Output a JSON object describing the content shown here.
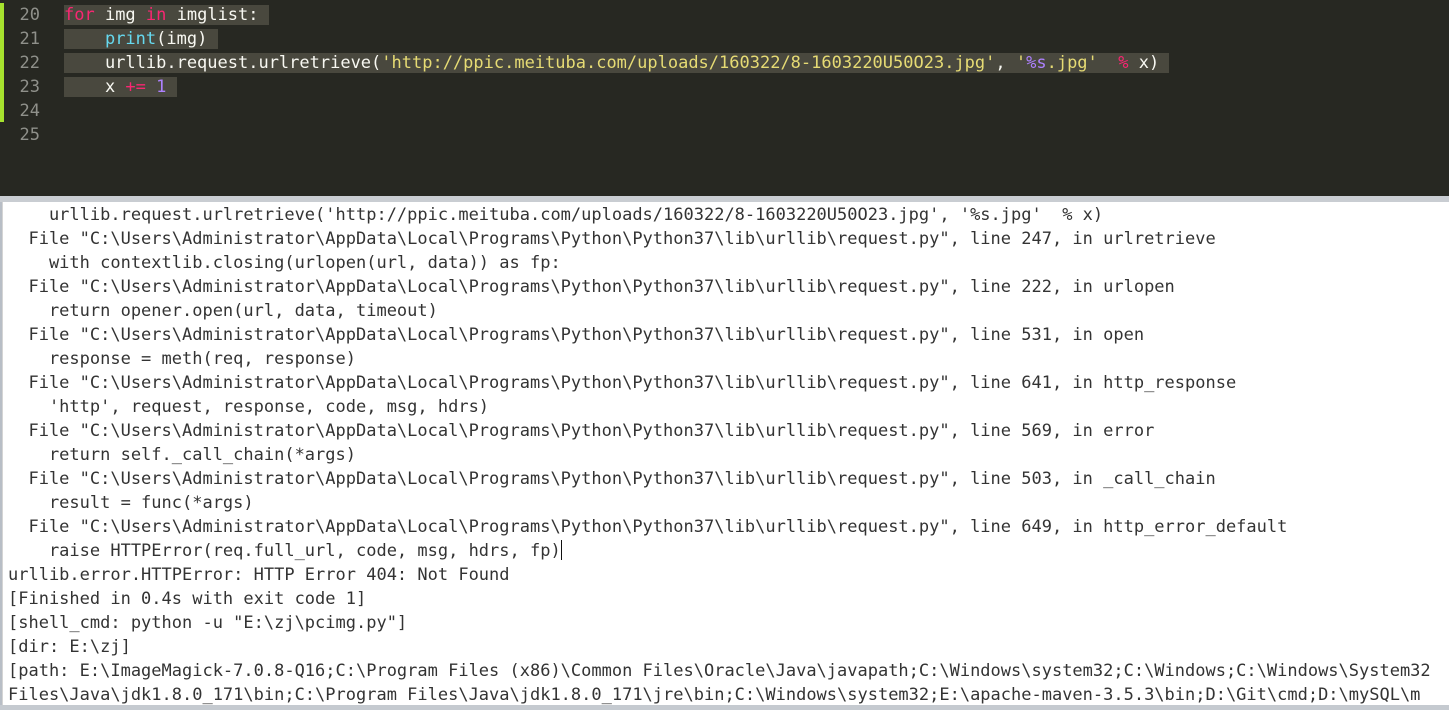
{
  "editor": {
    "lines": [
      {
        "num": "20",
        "segments": [
          {
            "t": "for",
            "c": "kw"
          },
          {
            "t": " img ",
            "c": ""
          },
          {
            "t": "in",
            "c": "kw"
          },
          {
            "t": " imglist: ",
            "c": ""
          }
        ]
      },
      {
        "num": "21",
        "segments": [
          {
            "t": "    ",
            "c": ""
          },
          {
            "t": "print",
            "c": "fn"
          },
          {
            "t": "(img) ",
            "c": ""
          }
        ]
      },
      {
        "num": "22",
        "segments": [
          {
            "t": "    urllib.request.urlretrieve(",
            "c": ""
          },
          {
            "t": "'http://ppic.meituba.com/uploads/160322/8-1603220U50O23.jpg'",
            "c": "str"
          },
          {
            "t": ", ",
            "c": ""
          },
          {
            "t": "'",
            "c": "str"
          },
          {
            "t": "%s",
            "c": "fmt"
          },
          {
            "t": ".jpg'",
            "c": "str"
          },
          {
            "t": "  ",
            "c": ""
          },
          {
            "t": "%",
            "c": "op"
          },
          {
            "t": " x) ",
            "c": ""
          }
        ]
      },
      {
        "num": "23",
        "segments": [
          {
            "t": "    x ",
            "c": ""
          },
          {
            "t": "+=",
            "c": "op"
          },
          {
            "t": " ",
            "c": ""
          },
          {
            "t": "1",
            "c": "num"
          },
          {
            "t": " ",
            "c": ""
          }
        ]
      },
      {
        "num": "24",
        "segments": []
      },
      {
        "num": "25",
        "segments": []
      }
    ]
  },
  "output": {
    "lines": [
      "    urllib.request.urlretrieve('http://ppic.meituba.com/uploads/160322/8-1603220U50O23.jpg', '%s.jpg'  % x)",
      "  File \"C:\\Users\\Administrator\\AppData\\Local\\Programs\\Python\\Python37\\lib\\urllib\\request.py\", line 247, in urlretrieve",
      "    with contextlib.closing(urlopen(url, data)) as fp:",
      "  File \"C:\\Users\\Administrator\\AppData\\Local\\Programs\\Python\\Python37\\lib\\urllib\\request.py\", line 222, in urlopen",
      "    return opener.open(url, data, timeout)",
      "  File \"C:\\Users\\Administrator\\AppData\\Local\\Programs\\Python\\Python37\\lib\\urllib\\request.py\", line 531, in open",
      "    response = meth(req, response)",
      "  File \"C:\\Users\\Administrator\\AppData\\Local\\Programs\\Python\\Python37\\lib\\urllib\\request.py\", line 641, in http_response",
      "    'http', request, response, code, msg, hdrs)",
      "  File \"C:\\Users\\Administrator\\AppData\\Local\\Programs\\Python\\Python37\\lib\\urllib\\request.py\", line 569, in error",
      "    return self._call_chain(*args)",
      "  File \"C:\\Users\\Administrator\\AppData\\Local\\Programs\\Python\\Python37\\lib\\urllib\\request.py\", line 503, in _call_chain",
      "    result = func(*args)",
      "  File \"C:\\Users\\Administrator\\AppData\\Local\\Programs\\Python\\Python37\\lib\\urllib\\request.py\", line 649, in http_error_default",
      "    raise HTTPError(req.full_url, code, msg, hdrs, fp)",
      "urllib.error.HTTPError: HTTP Error 404: Not Found",
      "[Finished in 0.4s with exit code 1]",
      "[shell_cmd: python -u \"E:\\zj\\pcimg.py\"]",
      "[dir: E:\\zj]",
      "[path: E:\\ImageMagick-7.0.8-Q16;C:\\Program Files (x86)\\Common Files\\Oracle\\Java\\javapath;C:\\Windows\\system32;C:\\Windows;C:\\Windows\\System32",
      "Files\\Java\\jdk1.8.0_171\\bin;C:\\Program Files\\Java\\jdk1.8.0_171\\jre\\bin;C:\\Windows\\system32;E:\\apache-maven-3.5.3\\bin;D:\\Git\\cmd;D:\\mySQL\\m"
    ],
    "cursor_line": 14
  },
  "colors": {
    "editor_bg": "#272822",
    "keyword": "#f92672",
    "builtin": "#66d9ef",
    "string": "#e6db74",
    "number": "#ae81ff",
    "output_bg": "#ffffff",
    "output_text": "#333333"
  }
}
